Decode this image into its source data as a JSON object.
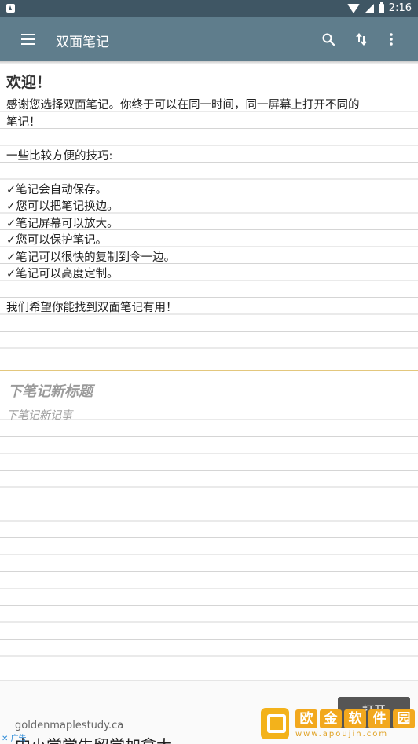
{
  "status_bar": {
    "time": "2:16"
  },
  "app_bar": {
    "title": "双面笔记"
  },
  "top_note": {
    "title": "欢迎！",
    "lines": [
      "感谢您选择双面笔记。你终于可以在同一时间，同一屏幕上打开不同的",
      "笔记！",
      "",
      "一些比较方便的技巧:",
      "",
      "✓笔记会自动保存。",
      "✓您可以把笔记换边。",
      "✓笔记屏幕可以放大。",
      "✓您可以保护笔记。",
      "✓笔记可以很快的复制到令一边。",
      "✓笔记可以高度定制。",
      "",
      "我们希望你能找到双面笔记有用！"
    ]
  },
  "bottom_note": {
    "title_placeholder": "下笔记新标题",
    "body_placeholder": "下笔记新记事"
  },
  "ad": {
    "domain": "goldenmaplestudy.ca",
    "headline": "中小学学生留学加拿大",
    "button_label": "打开",
    "adchoice_label": "广告"
  },
  "watermark": {
    "chars": [
      "欧",
      "金",
      "软",
      "件",
      "园"
    ],
    "url": "www.apoujin.com"
  },
  "colors": {
    "status_bar": "#3f5664",
    "app_bar": "#5f7d8c",
    "divider": "#e3c77d"
  }
}
